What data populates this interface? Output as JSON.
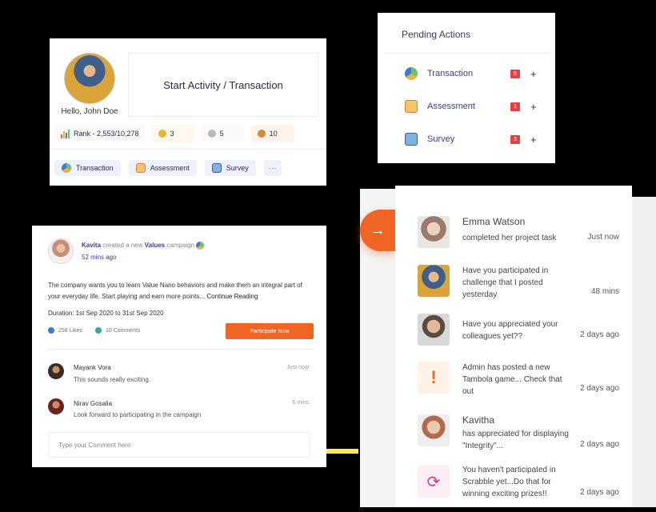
{
  "profile": {
    "greeting": "Hello, John Doe",
    "start_label": "Start Activity / Transaction",
    "rank": "Rank - 2,553/10,278",
    "gold": "3",
    "silver": "5",
    "bronze": "10",
    "actions": [
      {
        "label": "Transaction"
      },
      {
        "label": "Assessment"
      },
      {
        "label": "Survey"
      }
    ],
    "more": "···"
  },
  "pending": {
    "title": "Pending Actions",
    "items": [
      {
        "label": "Transaction",
        "count": "5"
      },
      {
        "label": "Assessment",
        "count": "1"
      },
      {
        "label": "Survey",
        "count": "3"
      }
    ]
  },
  "feed": {
    "author": "Kavita",
    "action_text": "created a new",
    "campaign": "Values",
    "campaign_suffix": "campaign",
    "time": "52 mins ago",
    "body": "The company wants you to learn Value Nano behaviors and make them an integral part of your everyday life. Start playing and earn more points...",
    "continue": "Continue Reading",
    "duration": "Duration: 1st Sep 2020 to 31st Sep 2020",
    "likes": "258 Likes",
    "comments": "10 Comments",
    "participate": "Participate Now",
    "comment_list": [
      {
        "name": "Mayank Vora",
        "text": "This sounds really exciting.",
        "time": "Just now"
      },
      {
        "name": "Nirav Gosalia",
        "text": "Look forward to participating in the campaign",
        "time": "5 mins"
      }
    ],
    "comment_placeholder": "Type your Comment here"
  },
  "notifications": [
    {
      "title": "Emma Watson",
      "text": "completed her project task",
      "time": "Just now"
    },
    {
      "title": "",
      "text": "Have you participated in challenge that I posted yesterday",
      "time": "48 mins"
    },
    {
      "title": "",
      "text": "Have you appreciated your colleagues yet??",
      "time": "2 days ago"
    },
    {
      "title": "",
      "text": "Admin has posted a new Tambola game... Check that out",
      "time": "2 days ago"
    },
    {
      "title": "Kavitha",
      "text": "has appreciated for displaying \"Integrity\"...",
      "time": "2 days ago"
    },
    {
      "title": "",
      "text": "You haven't participated in Scrabble yet...Do that for winning exciting prizes!!",
      "time": "2 days ago"
    }
  ],
  "colors": {
    "accent": "#f06525",
    "badge": "#e34242",
    "link": "#3a3f8a"
  }
}
